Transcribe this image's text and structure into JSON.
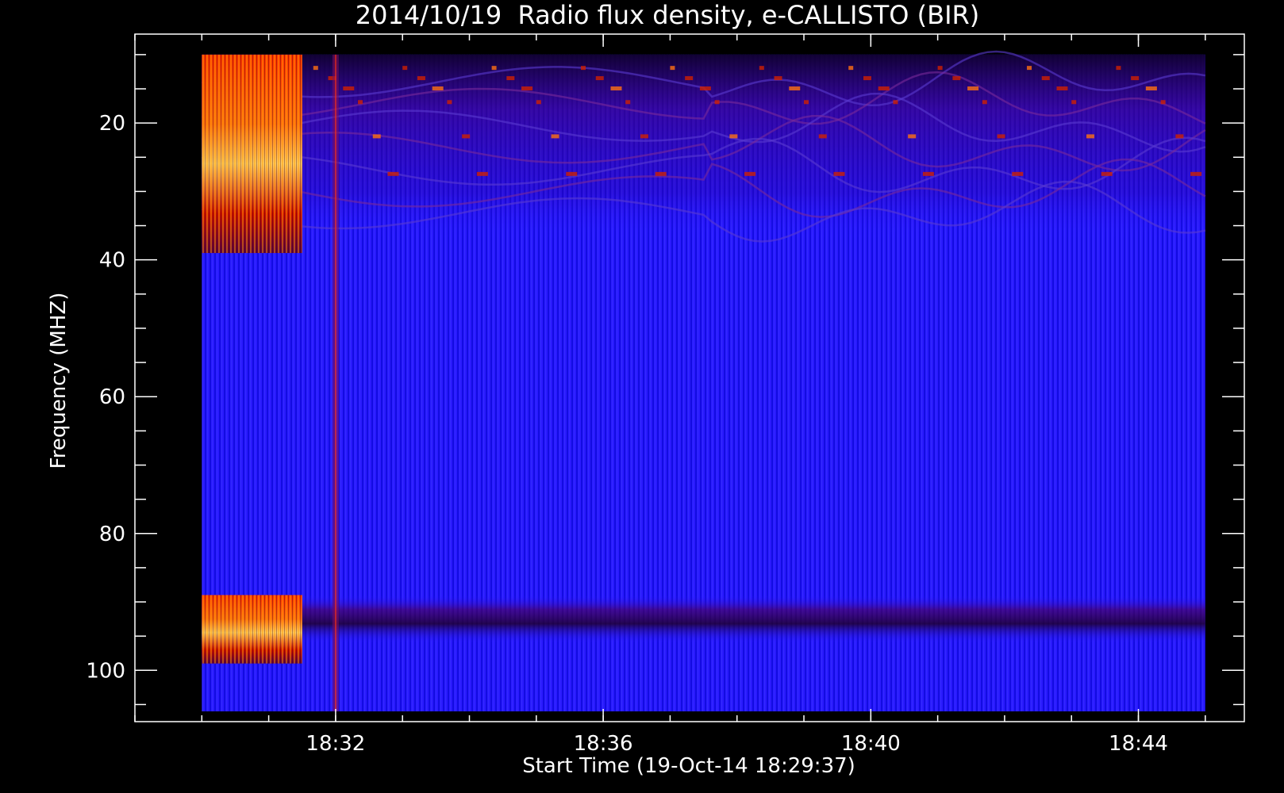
{
  "chart_data": {
    "type": "heatmap",
    "title": "2014/10/19  Radio flux density, e-CALLISTO (BIR)",
    "xlabel": "Start Time (19-Oct-14 18:29:37)",
    "ylabel": "Frequency (MHZ)",
    "x_ticks": [
      {
        "time": "18:32",
        "label": "18:32"
      },
      {
        "time": "18:36",
        "label": "18:36"
      },
      {
        "time": "18:40",
        "label": "18:40"
      },
      {
        "time": "18:44",
        "label": "18:44"
      }
    ],
    "y_ticks": [
      20,
      40,
      60,
      80,
      100
    ],
    "xlim": [
      "18:29:00",
      "18:45:35"
    ],
    "ylim": [
      107.5,
      7
    ],
    "data_extent": {
      "t_start": "18:30:00",
      "t_end": "18:45:00",
      "f_min": 10,
      "f_max": 106
    },
    "colormap": [
      "#000000",
      "#1a0066",
      "#0000ff",
      "#ff2000",
      "#ff8800",
      "#ffffaa"
    ],
    "background_level_color": "#2a1aff",
    "features": [
      {
        "name": "interference block",
        "t_start": "18:30:00",
        "t_end": "18:31:30",
        "f_min": 10,
        "f_max": 39
      },
      {
        "name": "interference block",
        "t_start": "18:30:00",
        "t_end": "18:31:30",
        "f_min": 89,
        "f_max": 99
      },
      {
        "name": "vertical streak",
        "time": "18:32:00"
      },
      {
        "name": "horizontal band",
        "f_min": 10,
        "f_max": 37
      },
      {
        "name": "horizontal band",
        "f_min": 89,
        "f_max": 96
      }
    ],
    "colors": {
      "background": "#000000",
      "axes": "#ffffff"
    }
  }
}
